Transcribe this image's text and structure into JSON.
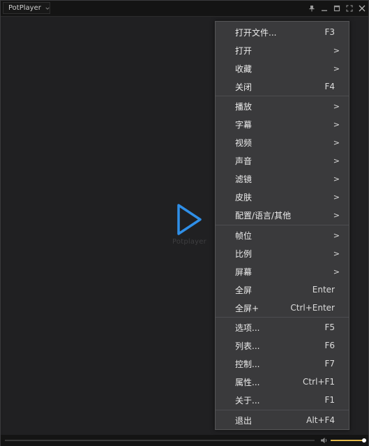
{
  "titlebar": {
    "app_name": "PotPlayer",
    "controls": [
      "pin-icon",
      "minimize-icon",
      "maximize-icon",
      "fullscreen-icon",
      "close-icon"
    ]
  },
  "player": {
    "logo_text": "Potplayer",
    "volume_level": 1.0,
    "seek_position": 0.0
  },
  "context_menu": {
    "items": [
      {
        "label": "打开文件...",
        "shortcut": "F3",
        "submenu": false
      },
      {
        "label": "打开",
        "shortcut": "",
        "submenu": true
      },
      {
        "label": "收藏",
        "shortcut": "",
        "submenu": true
      },
      {
        "label": "关闭",
        "shortcut": "F4",
        "submenu": false
      },
      {
        "label": "播放",
        "shortcut": "",
        "submenu": true
      },
      {
        "label": "字幕",
        "shortcut": "",
        "submenu": true
      },
      {
        "label": "视频",
        "shortcut": "",
        "submenu": true
      },
      {
        "label": "声音",
        "shortcut": "",
        "submenu": true
      },
      {
        "label": "滤镜",
        "shortcut": "",
        "submenu": true
      },
      {
        "label": "皮肤",
        "shortcut": "",
        "submenu": true
      },
      {
        "label": "配置/语言/其他",
        "shortcut": "",
        "submenu": true
      },
      {
        "label": "帧位",
        "shortcut": "",
        "submenu": true
      },
      {
        "label": "比例",
        "shortcut": "",
        "submenu": true
      },
      {
        "label": "屏幕",
        "shortcut": "",
        "submenu": true
      },
      {
        "label": "全屏",
        "shortcut": "Enter",
        "submenu": false
      },
      {
        "label": "全屏+",
        "shortcut": "Ctrl+Enter",
        "submenu": false
      },
      {
        "label": "选项...",
        "shortcut": "F5",
        "submenu": false
      },
      {
        "label": "列表...",
        "shortcut": "F6",
        "submenu": false
      },
      {
        "label": "控制...",
        "shortcut": "F7",
        "submenu": false
      },
      {
        "label": "属性...",
        "shortcut": "Ctrl+F1",
        "submenu": false
      },
      {
        "label": "关于...",
        "shortcut": "F1",
        "submenu": false
      },
      {
        "label": "退出",
        "shortcut": "Alt+F4",
        "submenu": false
      }
    ],
    "submenu_arrow": ">"
  },
  "colors": {
    "accent_logo": "#2f8fe8",
    "volume": "#e2b84a",
    "menu_bg": "#3a3a3c"
  }
}
